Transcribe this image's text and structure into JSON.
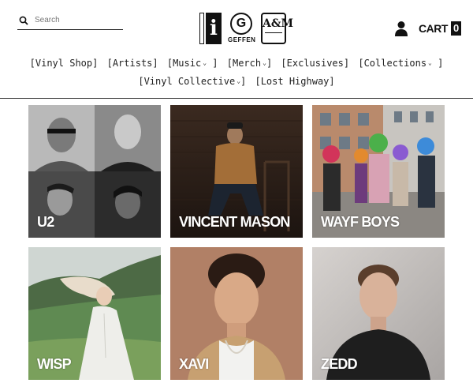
{
  "header": {
    "search_placeholder": "Search",
    "logos": {
      "interscope_letter": "i",
      "geffen_letter": "G",
      "geffen_word": "GEFFEN",
      "am_text": "A&M"
    },
    "cart_label": "CART",
    "cart_count": "0"
  },
  "nav": {
    "row1": [
      {
        "label": "[Vinyl Shop]",
        "dropdown": false
      },
      {
        "label": "[Artists]",
        "dropdown": false
      },
      {
        "label": "[Music",
        "dropdown": true,
        "close": "]"
      },
      {
        "label": "[Merch",
        "dropdown": true,
        "close": "]"
      },
      {
        "label": "[Exclusives]",
        "dropdown": false
      },
      {
        "label": "[Collections",
        "dropdown": true,
        "close": "]"
      }
    ],
    "row2": [
      {
        "label": "[Vinyl Collective",
        "dropdown": true,
        "close": "]"
      },
      {
        "label": "[Lost Highway]",
        "dropdown": false
      }
    ]
  },
  "artists": [
    {
      "name": "U2"
    },
    {
      "name": "VINCENT MASON"
    },
    {
      "name": "WAYF BOYS"
    },
    {
      "name": "WISP"
    },
    {
      "name": "XAVI"
    },
    {
      "name": "ZEDD"
    }
  ]
}
